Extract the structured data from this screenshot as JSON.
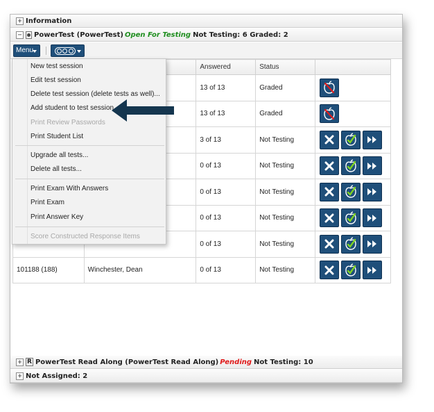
{
  "panels": {
    "information": {
      "toggle": "+",
      "title": "Information"
    },
    "powertest": {
      "toggle": "−",
      "title": "PowerTest (PowerTest)",
      "status": "Open For Testing",
      "summary": "Not Testing: 6 Graded: 2"
    },
    "readalong": {
      "toggle": "+",
      "icon_letter": "R",
      "title": "PowerTest Read Along (PowerTest Read Along)",
      "status": "Pending",
      "summary": "Not Testing: 10"
    },
    "not_assigned": {
      "toggle": "+",
      "title": "Not Assigned: 2"
    }
  },
  "toolbar": {
    "menu_label": "Menu"
  },
  "table": {
    "headers": [
      "",
      "",
      "Answered",
      "Status",
      ""
    ],
    "rows": [
      {
        "id": "",
        "name": "",
        "answered": "13 of 13",
        "status": "Graded",
        "actions": [
          "regrade"
        ]
      },
      {
        "id": "",
        "name": "",
        "answered": "13 of 13",
        "status": "Graded",
        "actions": [
          "regrade"
        ]
      },
      {
        "id": "",
        "name": "",
        "answered": "3 of 13",
        "status": "Not Testing",
        "actions": [
          "remove",
          "grade",
          "forward"
        ]
      },
      {
        "id": "",
        "name": "",
        "answered": "0 of 13",
        "status": "Not Testing",
        "actions": [
          "remove",
          "grade",
          "forward"
        ]
      },
      {
        "id": "",
        "name": "",
        "answered": "0 of 13",
        "status": "Not Testing",
        "actions": [
          "remove",
          "grade",
          "forward"
        ]
      },
      {
        "id": "",
        "name": "",
        "answered": "0 of 13",
        "status": "Not Testing",
        "actions": [
          "remove",
          "grade",
          "forward"
        ]
      },
      {
        "id": "",
        "name": "",
        "answered": "0 of 13",
        "status": "Not Testing",
        "actions": [
          "remove",
          "grade",
          "forward"
        ]
      },
      {
        "id": "101188 (188)",
        "name": "Winchester, Dean",
        "answered": "0 of 13",
        "status": "Not Testing",
        "actions": [
          "remove",
          "grade",
          "forward"
        ]
      }
    ]
  },
  "menu": {
    "items": [
      {
        "label": "New test session",
        "enabled": true
      },
      {
        "label": "Edit test session",
        "enabled": true
      },
      {
        "label": "Delete test session (delete tests as well)...",
        "enabled": true
      },
      {
        "label": "Add student to test session",
        "enabled": true
      },
      {
        "label": "Print Review Passwords",
        "enabled": false
      },
      {
        "label": "Print Student List",
        "enabled": true
      },
      {
        "label": "Upgrade all tests...",
        "enabled": true
      },
      {
        "label": "Delete all tests...",
        "enabled": true
      },
      {
        "label": "Print Exam With Answers",
        "enabled": true
      },
      {
        "label": "Print Exam",
        "enabled": true
      },
      {
        "label": "Print Answer Key",
        "enabled": true
      },
      {
        "label": "Score Constructed Response Items",
        "enabled": false
      }
    ]
  },
  "colors": {
    "button_bg": "#1f4f7a",
    "open_status": "#1f8e1f",
    "pending_status": "#e01b1b",
    "arrow": "#15364f"
  },
  "icons": {
    "remove": "x-icon",
    "grade": "apple-check-icon",
    "forward": "fast-forward-icon",
    "regrade": "apple-slash-icon"
  }
}
